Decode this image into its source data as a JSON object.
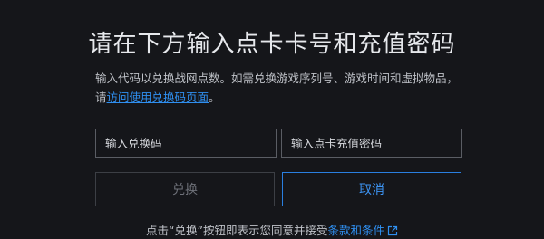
{
  "dialog": {
    "title": "请在下方输入点卡卡号和充值密码",
    "description_text": "输入代码以兑换战网点数。如需兑换游戏序列号、游戏时间和虚拟物品，请",
    "description_link": "访问使用兑换码页面",
    "description_end": "。",
    "code_input_placeholder": "输入兑换码",
    "card_input_placeholder": "输入点卡充值密码",
    "redeem_label": "兑换",
    "cancel_label": "取消",
    "terms_text": "点击“兑换”按钮即表示您同意并接受",
    "terms_link": "条款和条件"
  },
  "colors": {
    "background": "#15161a",
    "accent": "#2f8ff0",
    "disabled_text": "#6f727a"
  },
  "icons": {
    "terms_link_icon": "external-link-icon"
  }
}
